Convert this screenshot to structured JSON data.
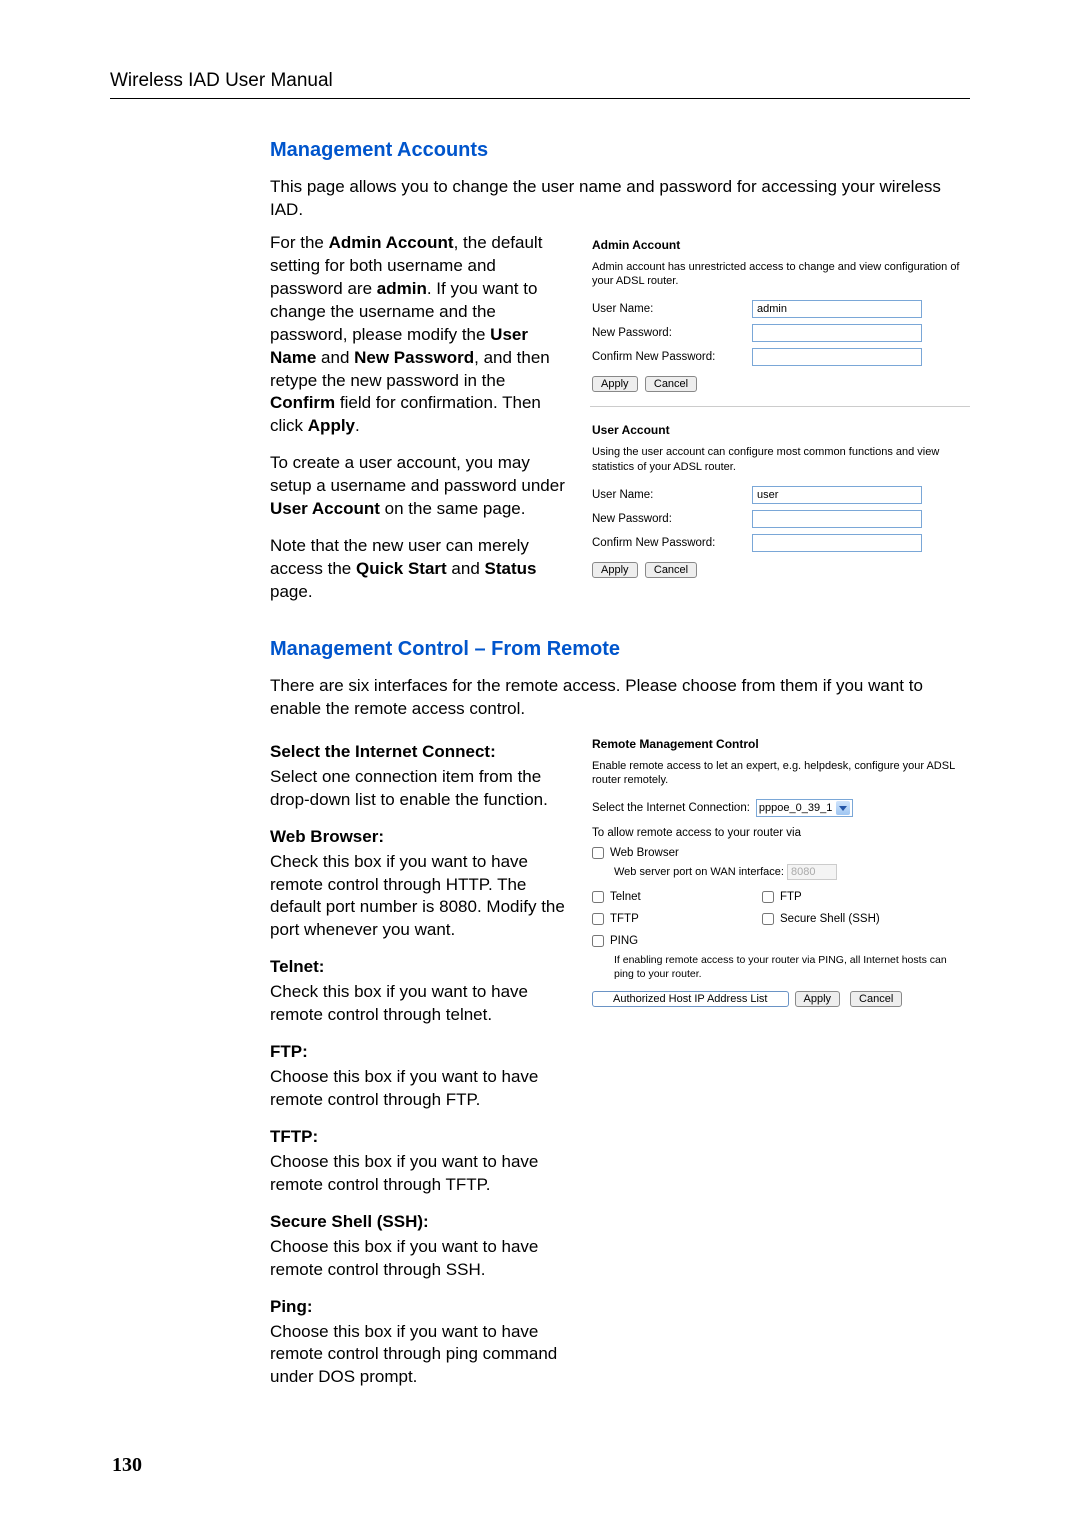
{
  "header": {
    "title": "Wireless IAD User Manual"
  },
  "page_number": "130",
  "section1": {
    "heading": "Management Accounts",
    "intro": "This page allows you to change the user name and password for accessing your wireless IAD.",
    "left": {
      "p1a": "For the ",
      "p1b": "Admin Account",
      "p1c": ", the default setting for both username and password are ",
      "p1d": "admin",
      "p1e": ". If you want to change the username and the password, please modify the ",
      "p1f": "User Name",
      "p1g": " and ",
      "p1h": "New Password",
      "p1i": ", and then retype the new password in the ",
      "p1j": "Confirm",
      "p1k": " field for confirmation. Then click ",
      "p1l": "Apply",
      "p1m": ".",
      "p2a": "To create a user account, you may setup a username and password under ",
      "p2b": "User Account",
      "p2c": " on the same page.",
      "p3a": "Note that the new user can merely access the ",
      "p3b": "Quick Start",
      "p3c": " and ",
      "p3d": "Status",
      "p3e": " page."
    },
    "admin_panel": {
      "title": "Admin Account",
      "desc": "Admin account has unrestricted access to change and view configuration of your ADSL router.",
      "user_label": "User Name:",
      "user_value": "admin",
      "newpwd_label": "New Password:",
      "confirm_label": "Confirm New Password:",
      "apply": "Apply",
      "cancel": "Cancel"
    },
    "user_panel": {
      "title": "User Account",
      "desc": "Using the user account can configure most common functions and view statistics of your ADSL router.",
      "user_label": "User Name:",
      "user_value": "user",
      "newpwd_label": "New Password:",
      "confirm_label": "Confirm New Password:",
      "apply": "Apply",
      "cancel": "Cancel"
    }
  },
  "section2": {
    "heading": "Management Control – From Remote",
    "intro": "There are six interfaces for the remote access. Please choose from them if you want to enable the remote access control.",
    "left": {
      "h1": "Select the Internet Connect:",
      "p1": "Select one connection item from the drop-down list to enable the function.",
      "h2": "Web Browser:",
      "p2": "Check this box if you want to have remote control through HTTP. The default port number is 8080. Modify the port whenever you want.",
      "h3": "Telnet:",
      "p3": "Check this box if you want to have remote control through telnet.",
      "h4": "FTP:",
      "p4": "Choose this box if you want to have remote control through FTP.",
      "h5": "TFTP:",
      "p5": "Choose this box if you want to have remote control through TFTP.",
      "h6": "Secure Shell (SSH):",
      "p6": "Choose this box if you want to have remote control through SSH.",
      "h7": "Ping:",
      "p7": "Choose this box if you want to have remote control through ping command under DOS prompt."
    },
    "remote_panel": {
      "title": "Remote Management Control",
      "desc": "Enable remote access to let an expert, e.g. helpdesk, configure your ADSL router remotely.",
      "select_label": "Select the Internet Connection:",
      "select_value": "pppoe_0_39_1",
      "allow_text": "To allow remote access to your router via",
      "web_browser": "Web Browser",
      "web_port_label": "Web server port on WAN interface:",
      "web_port_value": "8080",
      "telnet": "Telnet",
      "ftp": "FTP",
      "tftp": "TFTP",
      "ssh": "Secure Shell (SSH)",
      "ping": "PING",
      "ping_note": "If enabling remote access to your router via PING, all Internet hosts can ping to your router.",
      "host_btn": "Authorized Host IP Address List",
      "apply": "Apply",
      "cancel": "Cancel"
    }
  }
}
